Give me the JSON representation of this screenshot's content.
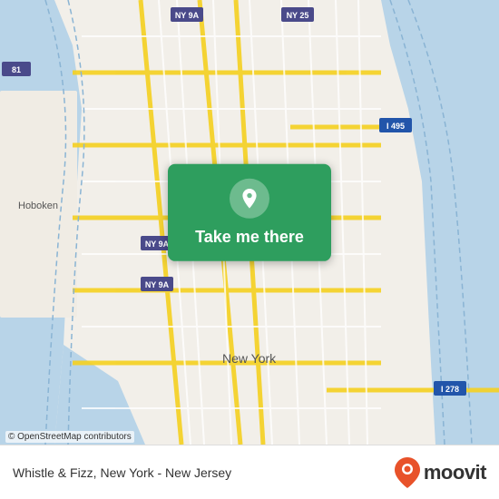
{
  "map": {
    "attribution": "© OpenStreetMap contributors",
    "center_label": "New York"
  },
  "overlay": {
    "button_label": "Take me there",
    "location_icon": "location-pin-icon"
  },
  "bottom_bar": {
    "place_name": "Whistle & Fizz, New York - New Jersey",
    "logo_text": "moovit"
  }
}
